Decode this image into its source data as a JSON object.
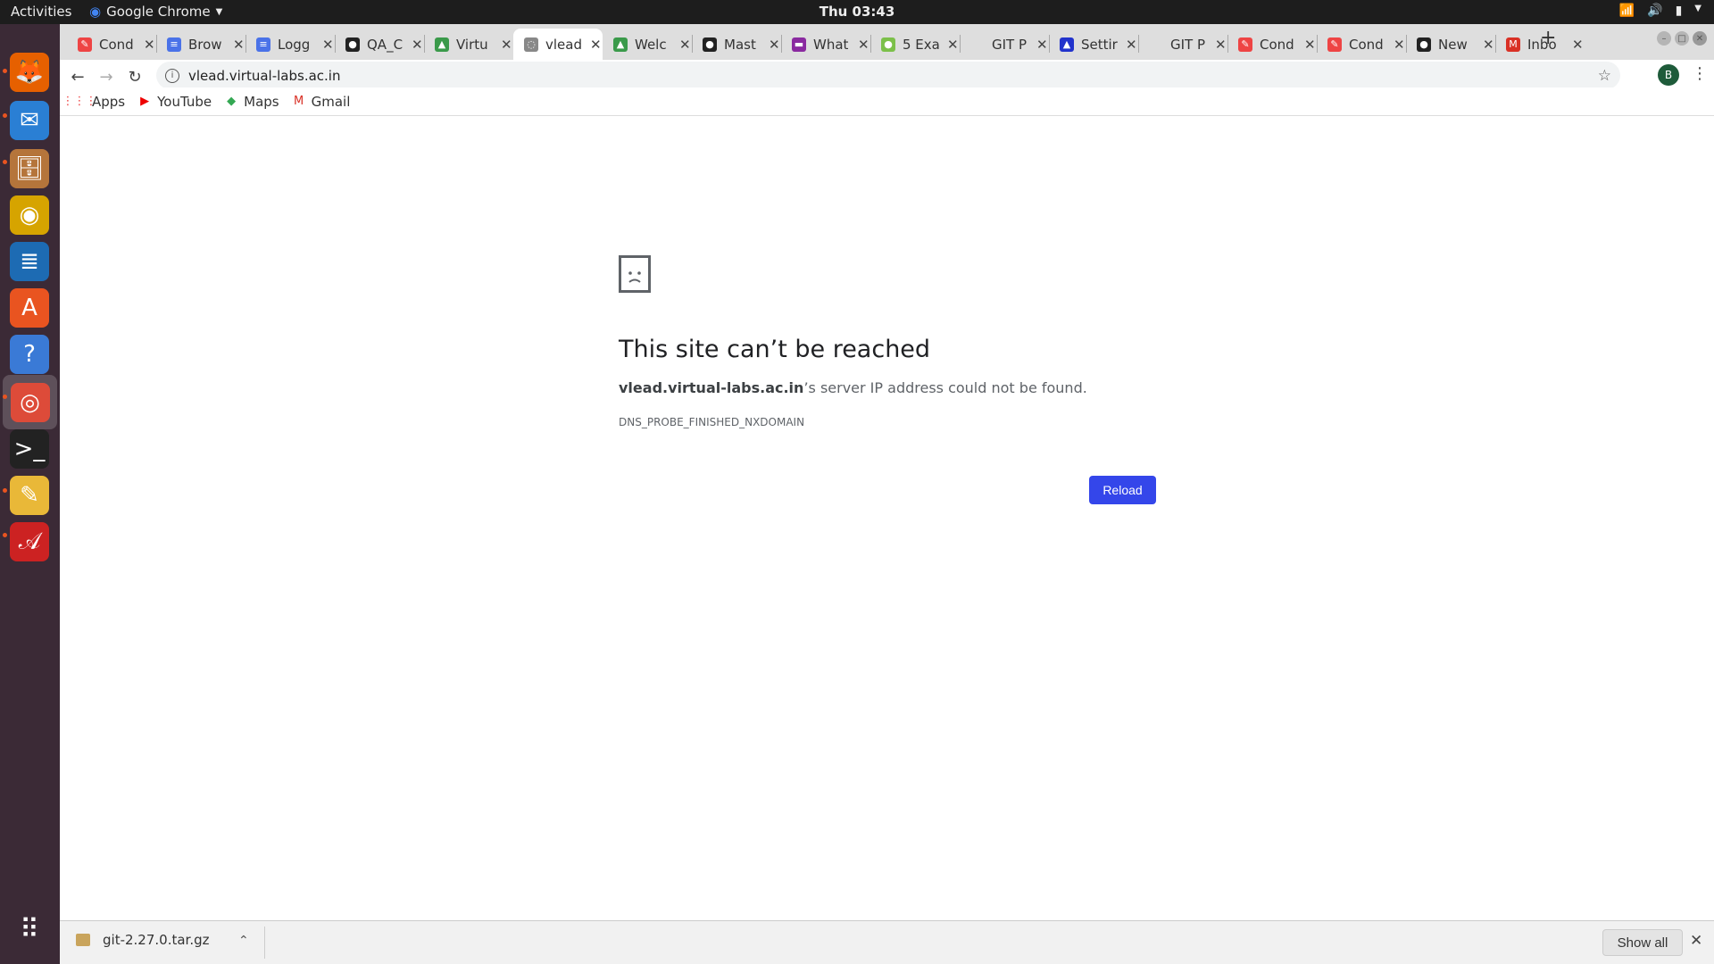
{
  "topbar": {
    "activities": "Activities",
    "app": "Google Chrome",
    "clock": "Thu 03:43"
  },
  "dock": {
    "items": [
      {
        "name": "firefox-icon",
        "glyph": "🦊",
        "color": "#e66000"
      },
      {
        "name": "thunderbird-icon",
        "glyph": "✉",
        "color": "#2a7fd4"
      },
      {
        "name": "files-icon",
        "glyph": "🗄",
        "color": "#b5753b"
      },
      {
        "name": "rhythmbox-icon",
        "glyph": "◉",
        "color": "#d6a400"
      },
      {
        "name": "writer-icon",
        "glyph": "≣",
        "color": "#1d6bb3"
      },
      {
        "name": "software-icon",
        "glyph": "A",
        "color": "#e95420"
      },
      {
        "name": "help-icon",
        "glyph": "?",
        "color": "#3a7ad6"
      },
      {
        "name": "chrome-icon",
        "glyph": "◎",
        "color": "#dd4b39"
      },
      {
        "name": "terminal-icon",
        "glyph": ">_",
        "color": "#222"
      },
      {
        "name": "text-editor-icon",
        "glyph": "✎",
        "color": "#e9b838"
      },
      {
        "name": "pdf-icon",
        "glyph": "𝒜",
        "color": "#cc2222"
      }
    ],
    "apps_grid": "⠿"
  },
  "tabs": [
    {
      "title": "Cond",
      "fav": "#e44",
      "glyph": "✎"
    },
    {
      "title": "Brow",
      "fav": "#4a72e8",
      "glyph": "≡"
    },
    {
      "title": "Logg",
      "fav": "#4a72e8",
      "glyph": "≡"
    },
    {
      "title": "QA_C",
      "fav": "#222",
      "glyph": "●"
    },
    {
      "title": "Virtu",
      "fav": "#3a9a4a",
      "glyph": "▲"
    },
    {
      "title": "vlead",
      "fav": "#888",
      "glyph": "◌"
    },
    {
      "title": "Welc",
      "fav": "#3a9a4a",
      "glyph": "▲"
    },
    {
      "title": "Mast",
      "fav": "#222",
      "glyph": "●"
    },
    {
      "title": "What",
      "fav": "#8a2aa0",
      "glyph": "▬"
    },
    {
      "title": "5 Exa",
      "fav": "#7cc04a",
      "glyph": "●"
    },
    {
      "title": "GIT P",
      "fav": "#dedede",
      "glyph": ""
    },
    {
      "title": "Settir",
      "fav": "#2233cc",
      "glyph": "▲"
    },
    {
      "title": "GIT P",
      "fav": "#dedede",
      "glyph": ""
    },
    {
      "title": "Cond",
      "fav": "#e44",
      "glyph": "✎"
    },
    {
      "title": "Cond",
      "fav": "#e44",
      "glyph": "✎"
    },
    {
      "title": "New",
      "fav": "#222",
      "glyph": "●"
    },
    {
      "title": "Inbo",
      "fav": "#d93025",
      "glyph": "M"
    }
  ],
  "active_tab": 5,
  "toolbar": {
    "url": "vlead.virtual-labs.ac.in",
    "profile": "B"
  },
  "bookmarks": [
    {
      "label": "Apps",
      "glyph": "⋮⋮⋮",
      "color": "#e44"
    },
    {
      "label": "YouTube",
      "glyph": "▶",
      "color": "#e00"
    },
    {
      "label": "Maps",
      "glyph": "◆",
      "color": "#34a853"
    },
    {
      "label": "Gmail",
      "glyph": "M",
      "color": "#d93025"
    }
  ],
  "error": {
    "title": "This site can’t be reached",
    "host": "vlead.virtual-labs.ac.in",
    "message": "’s server IP address could not be found.",
    "code": "DNS_PROBE_FINISHED_NXDOMAIN",
    "reload": "Reload"
  },
  "download": {
    "file": "git-2.27.0.tar.gz",
    "show_all": "Show all"
  }
}
